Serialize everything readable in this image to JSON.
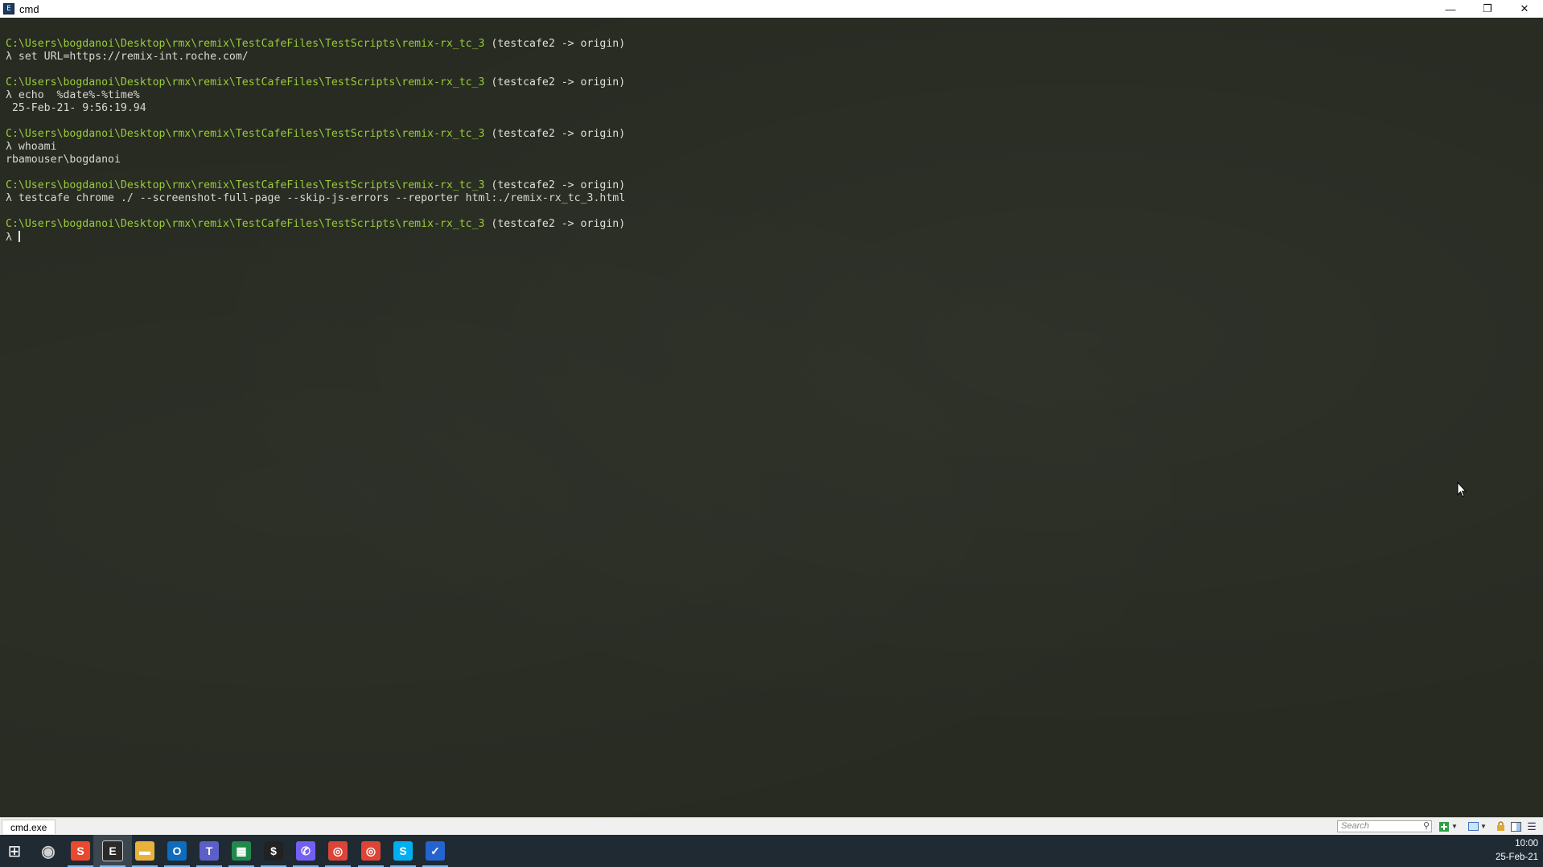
{
  "window": {
    "title": "cmd",
    "app_icon_glyph": "E",
    "minimize_label": "—",
    "restore_label": "❐",
    "close_label": "✕"
  },
  "console": {
    "prompt_symbol": "λ",
    "blocks": [
      {
        "path": "C:\\Users\\bogdanoi\\Desktop\\rmx\\remix\\TestCafeFiles\\TestScripts\\remix-rx_tc_3",
        "branch": "(testcafe2 -> origin)",
        "command": "set URL=https://remix-int.roche.com/",
        "output": []
      },
      {
        "path": "C:\\Users\\bogdanoi\\Desktop\\rmx\\remix\\TestCafeFiles\\TestScripts\\remix-rx_tc_3",
        "branch": "(testcafe2 -> origin)",
        "command": "echo  %date%-%time%",
        "output": [
          " 25-Feb-21- 9:56:19.94"
        ]
      },
      {
        "path": "C:\\Users\\bogdanoi\\Desktop\\rmx\\remix\\TestCafeFiles\\TestScripts\\remix-rx_tc_3",
        "branch": "(testcafe2 -> origin)",
        "command": "whoami",
        "output": [
          "rbamouser\\bogdanoi"
        ]
      },
      {
        "path": "C:\\Users\\bogdanoi\\Desktop\\rmx\\remix\\TestCafeFiles\\TestScripts\\remix-rx_tc_3",
        "branch": "(testcafe2 -> origin)",
        "command": "testcafe chrome ./ --screenshot-full-page --skip-js-errors --reporter html:./remix-rx_tc_3.html",
        "output": []
      },
      {
        "path": "C:\\Users\\bogdanoi\\Desktop\\rmx\\remix\\TestCafeFiles\\TestScripts\\remix-rx_tc_3",
        "branch": "(testcafe2 -> origin)",
        "command": "",
        "output": [],
        "current": true
      }
    ]
  },
  "statusbar": {
    "tab_label": "cmd.exe",
    "search_placeholder": "Search",
    "search_icon": "search-icon",
    "icons": [
      "add-console-icon",
      "dropdown-icon",
      "layout-icon",
      "dropdown-icon",
      "lock-icon",
      "split-view-icon",
      "menu-icon"
    ]
  },
  "taskbar": {
    "items": [
      {
        "name": "windows-start-icon",
        "glyph": "⊞",
        "color": "#ffffff"
      },
      {
        "name": "obs-icon",
        "glyph": "◉",
        "color": "#d0d0d0"
      },
      {
        "name": "sublime-text-icon",
        "glyph": "S",
        "color": "#e8492f"
      },
      {
        "name": "cmder-icon",
        "glyph": "E",
        "color": "#2a2a2a"
      },
      {
        "name": "file-explorer-icon",
        "glyph": "▬",
        "color": "#e8b23a"
      },
      {
        "name": "outlook-icon",
        "glyph": "O",
        "color": "#0f6cbd"
      },
      {
        "name": "teams-icon",
        "glyph": "T",
        "color": "#5b5fc7"
      },
      {
        "name": "spreadsheet-icon",
        "glyph": "▦",
        "color": "#1f8a4c"
      },
      {
        "name": "dollar-app-icon",
        "glyph": "$",
        "color": "#222222"
      },
      {
        "name": "viber-icon",
        "glyph": "✆",
        "color": "#7360f2"
      },
      {
        "name": "chrome-icon",
        "glyph": "◎",
        "color": "#db4437"
      },
      {
        "name": "chrome-profile-icon",
        "glyph": "◎",
        "color": "#db4437"
      },
      {
        "name": "skype-icon",
        "glyph": "S",
        "color": "#00aff0"
      },
      {
        "name": "todo-icon",
        "glyph": "✓",
        "color": "#2564cf"
      }
    ],
    "clock_time": "10:00",
    "clock_date": "25-Feb-21"
  }
}
